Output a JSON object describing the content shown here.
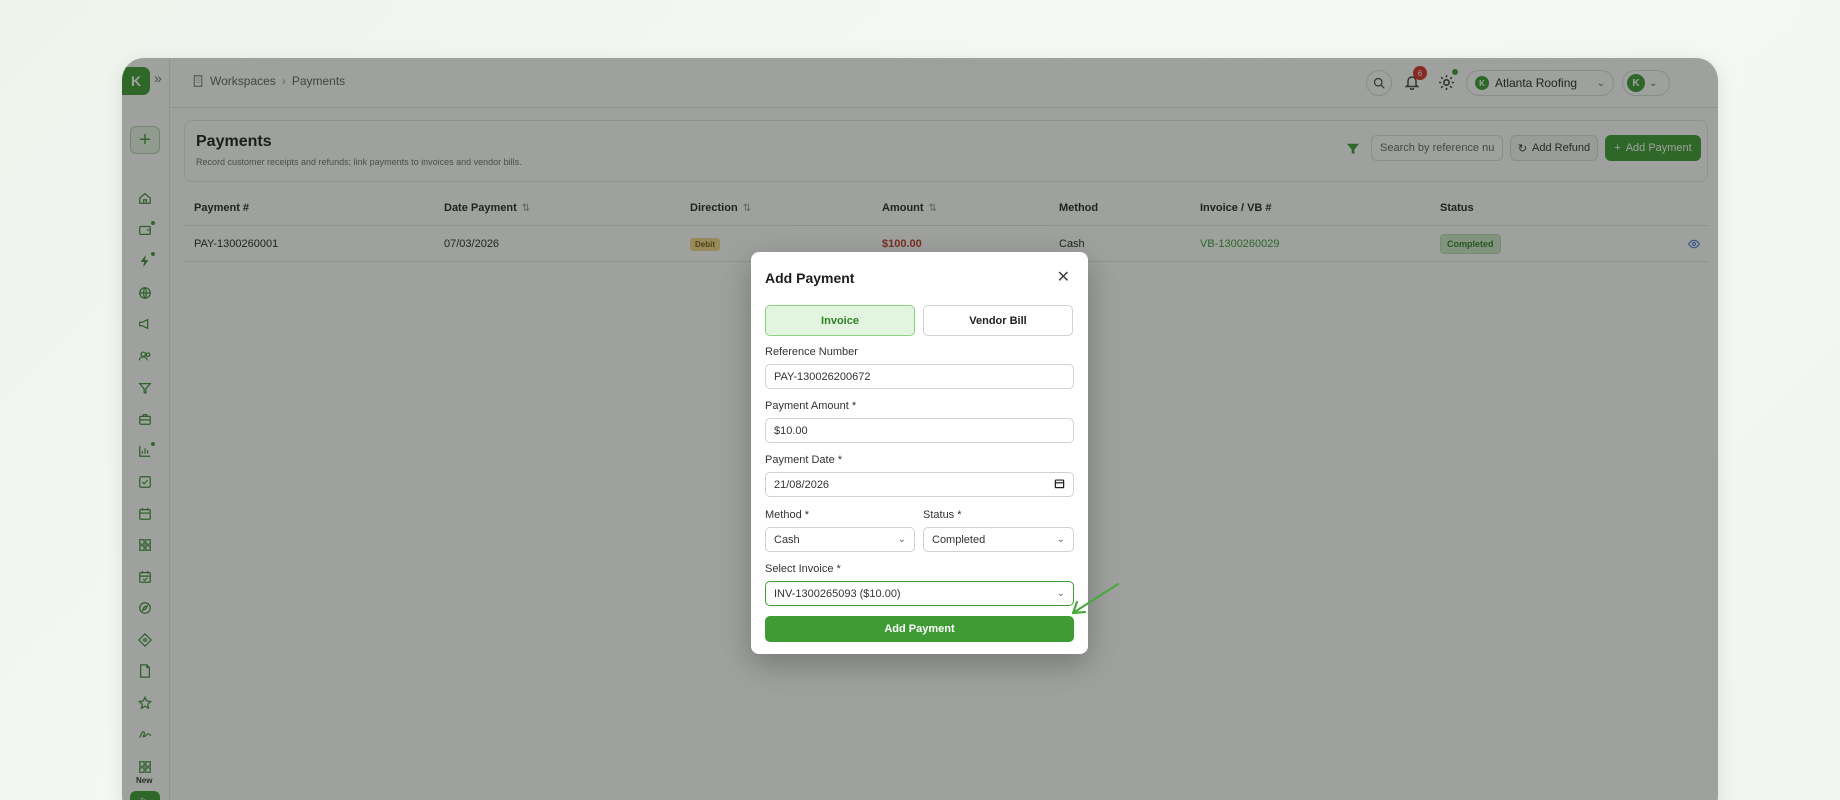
{
  "app": {
    "logo_letter": "K"
  },
  "breadcrumb": {
    "workspace": "Workspaces",
    "current": "Payments"
  },
  "topbar": {
    "notification_count": "6",
    "company_name": "Atlanta Roofing",
    "user_initial": "K"
  },
  "sidebar": {
    "new_label": "New",
    "items": [
      {
        "icon": "home-icon"
      },
      {
        "icon": "wallet-icon"
      },
      {
        "icon": "lightning-icon"
      },
      {
        "icon": "globe-icon"
      },
      {
        "icon": "megaphone-icon"
      },
      {
        "icon": "users-icon"
      },
      {
        "icon": "funnel-icon"
      },
      {
        "icon": "bank-icon"
      },
      {
        "icon": "chart-icon"
      },
      {
        "icon": "checkbox-icon"
      },
      {
        "icon": "calendar-icon"
      },
      {
        "icon": "grid-icon"
      },
      {
        "icon": "calendar-check-icon"
      },
      {
        "icon": "compass-icon"
      },
      {
        "icon": "tag-icon"
      },
      {
        "icon": "document-icon"
      },
      {
        "icon": "star-icon"
      },
      {
        "icon": "signature-icon"
      }
    ]
  },
  "header": {
    "title": "Payments",
    "subtitle": "Record customer receipts and refunds; link payments to invoices and vendor bills.",
    "search_placeholder": "Search by reference num",
    "refund_label": "Add Refund",
    "add_label": "Add Payment"
  },
  "table": {
    "columns": [
      "Payment #",
      "Date Payment",
      "Direction",
      "Amount",
      "Method",
      "Invoice / VB #",
      "Status"
    ],
    "rows": [
      {
        "payment": "PAY-1300260001",
        "date": "07/03/2026",
        "direction": "Debit",
        "amount": "$100.00",
        "method": "Cash",
        "invoice": "VB-1300260029",
        "status": "Completed"
      }
    ]
  },
  "modal": {
    "title": "Add Payment",
    "tab_invoice": "Invoice",
    "tab_vendor_bill": "Vendor Bill",
    "reference_label": "Reference Number",
    "reference_value": "PAY-130026200672",
    "amount_label": "Payment Amount *",
    "amount_value": "$10.00",
    "date_label": "Payment Date *",
    "date_value": "21/08/2026",
    "method_label": "Method *",
    "method_value": "Cash",
    "status_label": "Status *",
    "status_value": "Completed",
    "invoice_label": "Select Invoice *",
    "invoice_value": "INV-1300265093 ($10.00)",
    "submit_label": "Add Payment"
  },
  "colors": {
    "brand_green": "#3f9c35",
    "danger_red": "#c0392b",
    "badge_red": "#d9322b"
  }
}
